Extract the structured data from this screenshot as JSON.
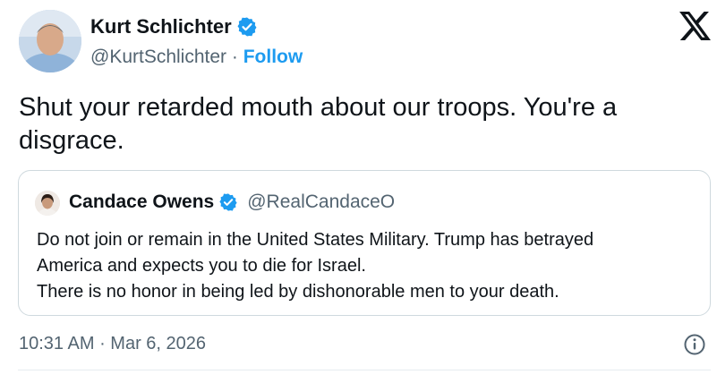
{
  "author": {
    "name": "Kurt Schlichter",
    "handle": "@KurtSchlichter",
    "separator": "·",
    "follow_label": "Follow",
    "verified": true
  },
  "tweet": {
    "text": "Shut your retarded mouth about our troops. You're a disgrace."
  },
  "quoted": {
    "name": "Candace Owens",
    "handle": "@RealCandaceO",
    "verified": true,
    "lines": [
      "Do not join or remain in the United States Military. Trump has betrayed",
      "America and expects you to die for Israel.",
      "There is no honor in being led by dishonorable men to your death."
    ]
  },
  "footer": {
    "time": "10:31 AM",
    "separator": "·",
    "date": "Mar 6, 2026"
  },
  "colors": {
    "accent": "#1d9bf0",
    "text": "#0f1419",
    "muted": "#536471",
    "border": "#cfd9de"
  },
  "icons": {
    "brand": "x-logo-icon",
    "verified": "verified-badge-icon",
    "info": "info-icon"
  }
}
